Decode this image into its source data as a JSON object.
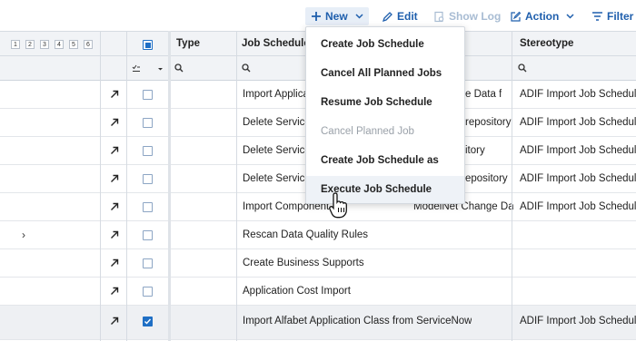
{
  "toolbar": {
    "new_label": "New",
    "edit_label": "Edit",
    "show_log_label": "Show Log",
    "action_label": "Action",
    "filter_label": "Filter"
  },
  "grid": {
    "level_buttons": [
      "1",
      "2",
      "3",
      "4",
      "5",
      "6"
    ],
    "columns": {
      "type": "Type",
      "job_schedule": "Job Schedule",
      "stereotype": "Stereotype"
    },
    "rows": [
      {
        "job_schedule": "Import Applica",
        "job_schedule_tail": "e Data f",
        "stereotype": "ADIF Import Job Schedule",
        "checked": false,
        "expandable": false,
        "selected": false
      },
      {
        "job_schedule": "Delete Service",
        "job_schedule_tail": "repository",
        "stereotype": "ADIF Import Job Schedule",
        "checked": false,
        "expandable": false,
        "selected": false
      },
      {
        "job_schedule": "Delete Service",
        "job_schedule_tail": "itory",
        "stereotype": "ADIF Import Job Schedule",
        "checked": false,
        "expandable": false,
        "selected": false
      },
      {
        "job_schedule": "Delete Service",
        "job_schedule_tail": "epository",
        "stereotype": "ADIF Import Job Schedule",
        "checked": false,
        "expandable": false,
        "selected": false
      },
      {
        "job_schedule": "Import Component",
        "job_schedule_tail": "ModelNet Change Da",
        "stereotype": "ADIF Import Job Schedule",
        "checked": false,
        "expandable": false,
        "selected": false
      },
      {
        "job_schedule": "Rescan Data Quality Rules",
        "job_schedule_tail": "",
        "stereotype": "",
        "checked": false,
        "expandable": true,
        "selected": false
      },
      {
        "job_schedule": "Create Business Supports",
        "job_schedule_tail": "",
        "stereotype": "",
        "checked": false,
        "expandable": false,
        "selected": false
      },
      {
        "job_schedule": "Application Cost Import",
        "job_schedule_tail": "",
        "stereotype": "",
        "checked": false,
        "expandable": false,
        "selected": false
      },
      {
        "job_schedule": "Import Alfabet Application Class from ServiceNow",
        "job_schedule_tail": "",
        "stereotype": "ADIF Import Job Schedule",
        "checked": true,
        "expandable": false,
        "selected": true
      }
    ]
  },
  "new_menu": {
    "items": [
      {
        "label": "Create Job Schedule",
        "disabled": false
      },
      {
        "label": "Cancel All Planned Jobs",
        "disabled": false
      },
      {
        "label": "Resume Job Schedule",
        "disabled": false
      },
      {
        "label": "Cancel Planned Job",
        "disabled": true
      },
      {
        "label": "Create Job Schedule as Copy",
        "disabled": false
      },
      {
        "label": "Execute Job Schedule",
        "disabled": false
      }
    ],
    "hovered_index": 5
  }
}
